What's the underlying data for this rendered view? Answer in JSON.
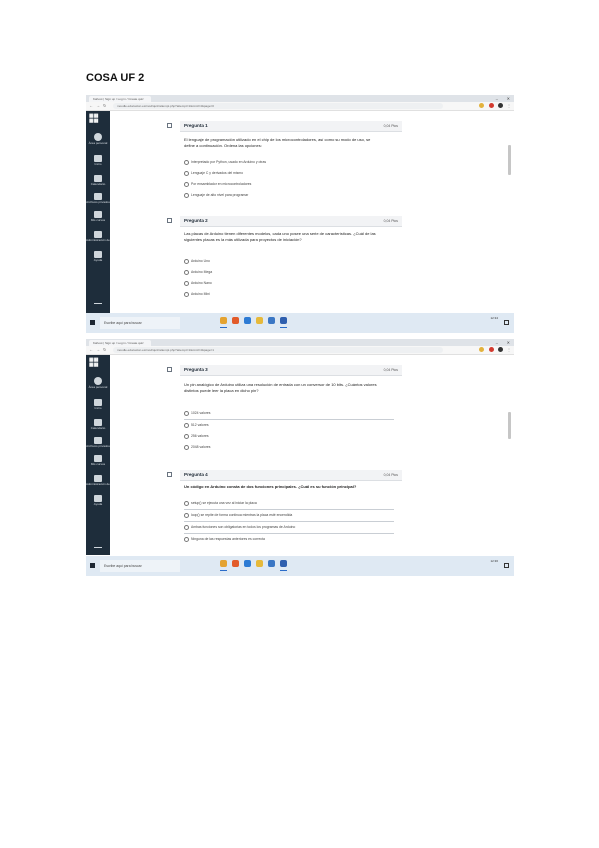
{
  "document": {
    "title": "COSA UF 2"
  },
  "screenshots": [
    {
      "tab_title": "Kahoot | Sign up / Log in / Create quiz",
      "url": "moodle.educacion.es/mod/quiz/attempt.php?attempt=1&cmid=4&page=0",
      "sidebar": [
        "Área personal",
        "Inicio",
        "Calendario",
        "Archivos privados",
        "Mis cursos",
        "Administración del sitio",
        "Ayuda"
      ],
      "questions": [
        {
          "title": "Pregunta 1",
          "points": "0,04 Ptos",
          "text": "El lenguaje de programación utilizado en el chip de los microcontroladores, así como su modo de uso, se define a continuación. Ordena las opciones:",
          "options": [
            "Interpretado por Python, usado en Arduino y otras",
            "Lenguaje C y derivados del mismo",
            "Por ensamblador en microcontroladores",
            "Lenguaje de alto nivel para programar"
          ]
        },
        {
          "title": "Pregunta 2",
          "points": "0,04 Ptos",
          "text": "Las placas de Arduino tienen diferentes modelos, cada uno posee una serie de características. ¿Cuál de las siguientes placas es la más utilizada para proyectos de iniciación?",
          "options": [
            "Arduino Uno",
            "Arduino Mega",
            "Arduino Nano",
            "Arduino Mini"
          ]
        }
      ],
      "taskbar_search": "Escribe aquí para buscar",
      "clock": "12:34"
    },
    {
      "tab_title": "Kahoot | Sign up / Log in / Create quiz",
      "url": "moodle.educacion.es/mod/quiz/attempt.php?attempt=1&cmid=4&page=1",
      "sidebar": [
        "Área personal",
        "Inicio",
        "Calendario",
        "Archivos privados",
        "Mis cursos",
        "Administración del sitio",
        "Ayuda"
      ],
      "questions": [
        {
          "title": "Pregunta 3",
          "points": "0,04 Ptos",
          "text": "Un pin analógico de Arduino utiliza una resolución de entrada con un conversor de 10 bits. ¿Cuántos valores distintos puede leer la placa en dicho pin?",
          "options": [
            "1024 valores",
            "512 valores",
            "256 valores",
            "2048 valores"
          ]
        },
        {
          "title": "Pregunta 4",
          "points": "0,04 Ptos",
          "text": "Un código en Arduino consta de dos funciones principales. ¿Cuál es su función principal?",
          "options": [
            "setup() se ejecuta una vez al iniciar la placa",
            "loop() se repite de forma continua mientras la placa esté encendida",
            "Ambas funciones son obligatorias en todos los programas de Arduino",
            "Ninguna de las respuestas anteriores es correcta"
          ]
        }
      ],
      "taskbar_search": "Escribe aquí para buscar",
      "clock": "12:36"
    }
  ]
}
